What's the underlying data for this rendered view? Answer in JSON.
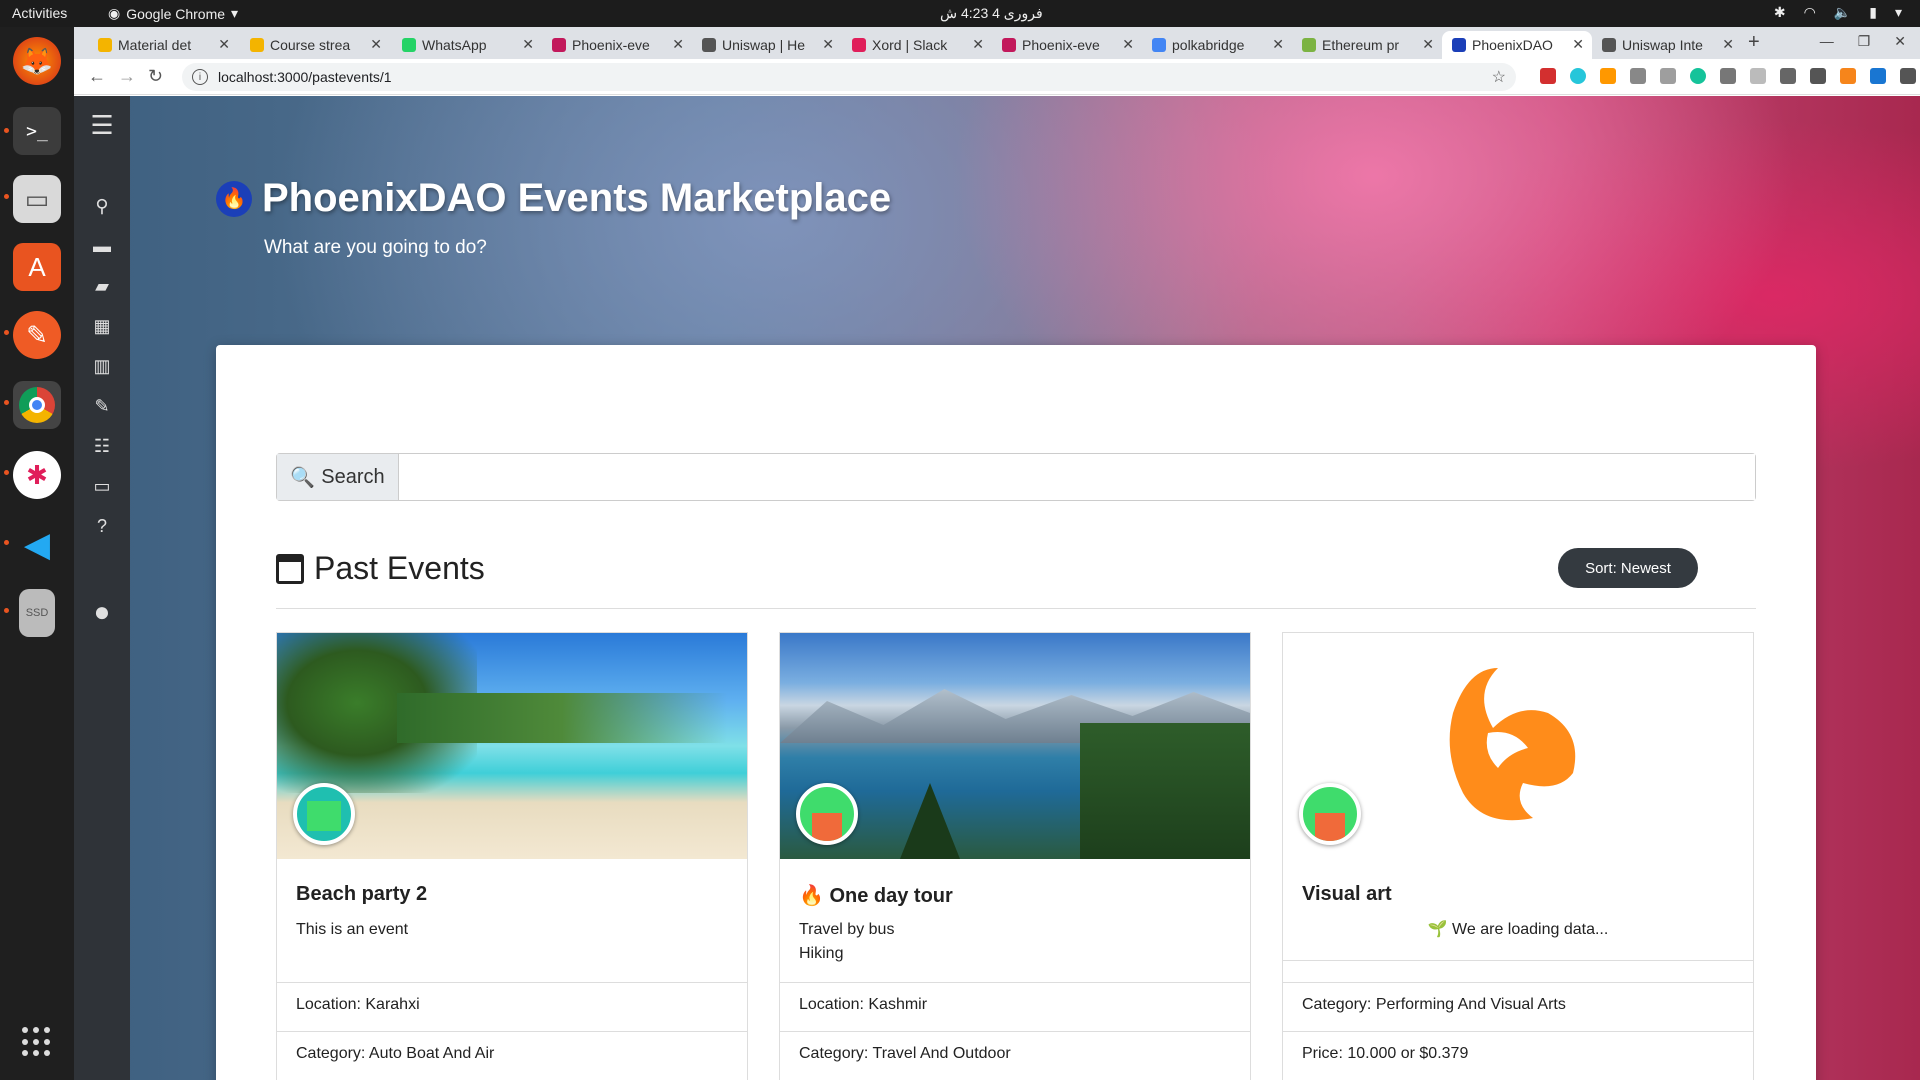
{
  "topbar": {
    "activities": "Activities",
    "app_name": "Google Chrome",
    "clock": "فروری 4  4:23 ش"
  },
  "tabs": [
    {
      "label": "Material det",
      "color": "#f4b400"
    },
    {
      "label": "Course strea",
      "color": "#f4b400"
    },
    {
      "label": "WhatsApp",
      "color": "#25d366"
    },
    {
      "label": "Phoenix-eve",
      "color": "#c2185b"
    },
    {
      "label": "Uniswap | He",
      "color": "#555555"
    },
    {
      "label": "Xord | Slack",
      "color": "#e01e5a"
    },
    {
      "label": "Phoenix-eve",
      "color": "#c2185b"
    },
    {
      "label": "polkabridge",
      "color": "#4285f4"
    },
    {
      "label": "Ethereum pr",
      "color": "#7cb342"
    },
    {
      "label": "PhoenixDAO",
      "color": "#1b3fb8"
    },
    {
      "label": "Uniswap Inte",
      "color": "#555555"
    }
  ],
  "address_bar": {
    "url": "localhost:3000/pastevents/1"
  },
  "page": {
    "title": "PhoenixDAO Events Marketplace",
    "subtitle": "What are you going to do?",
    "search_label": "Search",
    "search_value": "",
    "section_title": "Past Events",
    "sort_label": "Sort: Newest"
  },
  "events": [
    {
      "title": "Beach party 2",
      "description": [
        "This is an event"
      ],
      "location": "Location: Karahxi",
      "category": "Category: Auto Boat And Air"
    },
    {
      "title": "🔥 One day tour",
      "description": [
        "Travel by bus",
        "Hiking"
      ],
      "location": "Location: Kashmir",
      "category": "Category: Travel And Outdoor"
    },
    {
      "title": "Visual art",
      "loading": "🌱 We are loading data...",
      "category": "Category: Performing And Visual Arts",
      "price": "Price:  10.000 or $0.379"
    }
  ],
  "colors": {
    "sidebar": "#2f3338",
    "sort_button": "#343a40",
    "brand_blue": "#1b3fb8",
    "phoenix_orange": "#ff9a1f"
  }
}
